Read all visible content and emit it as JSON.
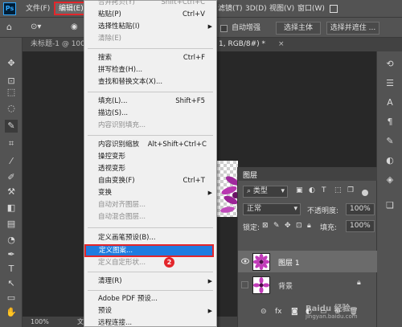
{
  "menubar": {
    "app_icon": "Ps",
    "items": [
      "文件(F)",
      "编辑(E)",
      "滤镜(T)",
      "3D(D)",
      "视图(V)",
      "窗口(W)"
    ],
    "right_icon": "help-icon"
  },
  "step_badges": [
    "1",
    "2"
  ],
  "options_bar": {
    "auto_enhance": "自动增强",
    "select_subject": "选择主体",
    "select_mask": "选择并遮住 ..."
  },
  "tabs": {
    "tab1": "未标题-1 @ 100%",
    "tab2": "1, RGB/8#) *"
  },
  "status_bar": {
    "zoom": "100%",
    "doc_label": "文"
  },
  "edit_menu": {
    "items": [
      {
        "label": "合并拷贝(Y)",
        "shortcut": "Shift+Ctrl+C",
        "disabled": true
      },
      {
        "label": "粘贴(P)",
        "shortcut": "Ctrl+V"
      },
      {
        "label": "选择性粘贴(I)",
        "shortcut": "",
        "submenu": true
      },
      {
        "label": "清除(E)",
        "shortcut": "",
        "disabled": true
      },
      {
        "label": "搜索",
        "shortcut": "Ctrl+F"
      },
      {
        "label": "拼写检查(H)...",
        "shortcut": ""
      },
      {
        "label": "查找和替换文本(X)...",
        "shortcut": ""
      },
      {
        "label": "填充(L)...",
        "shortcut": "Shift+F5"
      },
      {
        "label": "描边(S)...",
        "shortcut": ""
      },
      {
        "label": "内容识别填充...",
        "shortcut": "",
        "disabled": true
      },
      {
        "label": "内容识别缩放",
        "shortcut": "Alt+Shift+Ctrl+C"
      },
      {
        "label": "操控变形",
        "shortcut": ""
      },
      {
        "label": "透视变形",
        "shortcut": ""
      },
      {
        "label": "自由变换(F)",
        "shortcut": "Ctrl+T"
      },
      {
        "label": "变换",
        "shortcut": "",
        "submenu": true
      },
      {
        "label": "自动对齐图层...",
        "shortcut": "",
        "disabled": true
      },
      {
        "label": "自动混合图层...",
        "shortcut": "",
        "disabled": true
      },
      {
        "label": "定义画笔预设(B)...",
        "shortcut": ""
      },
      {
        "label": "定义图案...",
        "shortcut": "",
        "highlighted": true
      },
      {
        "label": "定义自定形状...",
        "shortcut": "",
        "disabled": true
      },
      {
        "label": "清理(R)",
        "shortcut": "",
        "submenu": true
      },
      {
        "label": "Adobe PDF 预设...",
        "shortcut": ""
      },
      {
        "label": "预设",
        "shortcut": "",
        "submenu": true
      },
      {
        "label": "远程连接...",
        "shortcut": ""
      }
    ]
  },
  "layers_panel": {
    "title": "图层",
    "filter_kind": "类型",
    "blend_mode": "正常",
    "opacity_label": "不透明度:",
    "opacity_value": "100%",
    "lock_label": "锁定:",
    "fill_label": "填充:",
    "fill_value": "100%",
    "layers": [
      {
        "name": "图层 1",
        "visible": true,
        "selected": true
      },
      {
        "name": "背景",
        "visible": false,
        "selected": false
      }
    ],
    "bottom_icons": [
      "link-icon",
      "fx-icon",
      "mask-icon",
      "adjustment-icon",
      "group-icon",
      "new-layer-icon",
      "trash-icon"
    ]
  },
  "watermark": "Baidu 经验",
  "watermark_sub": "jingyan.baidu.com",
  "colors": {
    "highlight": "#1f7ce0",
    "annotation_red": "#e3262b",
    "ui_dark": "#535353"
  }
}
